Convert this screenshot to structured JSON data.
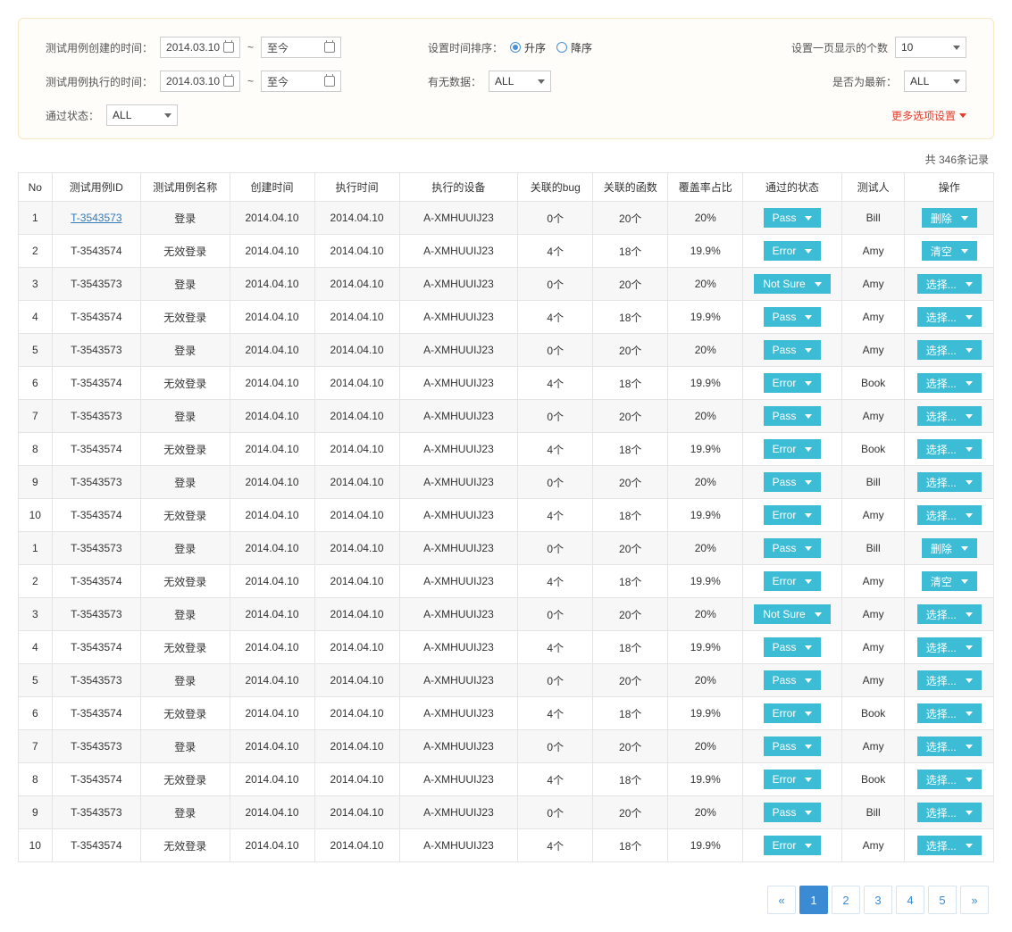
{
  "filters": {
    "created_label": "测试用例创建的时间：",
    "created_from": "2014.03.10",
    "created_to": "至今",
    "executed_label": "测试用例执行的时间：",
    "executed_from": "2014.03.10",
    "executed_to": "至今",
    "sort_label": "设置时间排序：",
    "sort_asc": "升序",
    "sort_desc": "降序",
    "sort_selected": "asc",
    "has_data_label": "有无数据：",
    "has_data_value": "ALL",
    "page_size_label": "设置一页显示的个数",
    "page_size_value": "10",
    "is_latest_label": "是否为最新：",
    "is_latest_value": "ALL",
    "pass_state_label": "通过状态：",
    "pass_state_value": "ALL",
    "more_options": "更多选项设置"
  },
  "count_label": "共 346条记录",
  "columns": [
    "No",
    "测试用例ID",
    "测试用例名称",
    "创建时间",
    "执行时间",
    "执行的设备",
    "关联的bug",
    "关联的函数",
    "覆盖率占比",
    "通过的状态",
    "测试人",
    "操作"
  ],
  "rows": [
    {
      "no": "1",
      "id": "T-3543573",
      "id_link": true,
      "name": "登录",
      "cdate": "2014.04.10",
      "edate": "2014.04.10",
      "device": "A-XMHUUIJ23",
      "bug": "0个",
      "fn": "20个",
      "cov": "20%",
      "state": "Pass",
      "tester": "Bill",
      "action": "删除"
    },
    {
      "no": "2",
      "id": "T-3543574",
      "name": "无效登录",
      "cdate": "2014.04.10",
      "edate": "2014.04.10",
      "device": "A-XMHUUIJ23",
      "bug": "4个",
      "fn": "18个",
      "cov": "19.9%",
      "state": "Error",
      "tester": "Amy",
      "action": "清空"
    },
    {
      "no": "3",
      "id": "T-3543573",
      "name": "登录",
      "cdate": "2014.04.10",
      "edate": "2014.04.10",
      "device": "A-XMHUUIJ23",
      "bug": "0个",
      "fn": "20个",
      "cov": "20%",
      "state": "Not Sure",
      "tester": "Amy",
      "action": "选择..."
    },
    {
      "no": "4",
      "id": "T-3543574",
      "name": "无效登录",
      "cdate": "2014.04.10",
      "edate": "2014.04.10",
      "device": "A-XMHUUIJ23",
      "bug": "4个",
      "fn": "18个",
      "cov": "19.9%",
      "state": "Pass",
      "tester": "Amy",
      "action": "选择..."
    },
    {
      "no": "5",
      "id": "T-3543573",
      "name": "登录",
      "cdate": "2014.04.10",
      "edate": "2014.04.10",
      "device": "A-XMHUUIJ23",
      "bug": "0个",
      "fn": "20个",
      "cov": "20%",
      "state": "Pass",
      "tester": "Amy",
      "action": "选择..."
    },
    {
      "no": "6",
      "id": "T-3543574",
      "name": "无效登录",
      "cdate": "2014.04.10",
      "edate": "2014.04.10",
      "device": "A-XMHUUIJ23",
      "bug": "4个",
      "fn": "18个",
      "cov": "19.9%",
      "state": "Error",
      "tester": "Book",
      "action": "选择..."
    },
    {
      "no": "7",
      "id": "T-3543573",
      "name": "登录",
      "cdate": "2014.04.10",
      "edate": "2014.04.10",
      "device": "A-XMHUUIJ23",
      "bug": "0个",
      "fn": "20个",
      "cov": "20%",
      "state": "Pass",
      "tester": "Amy",
      "action": "选择..."
    },
    {
      "no": "8",
      "id": "T-3543574",
      "name": "无效登录",
      "cdate": "2014.04.10",
      "edate": "2014.04.10",
      "device": "A-XMHUUIJ23",
      "bug": "4个",
      "fn": "18个",
      "cov": "19.9%",
      "state": "Error",
      "tester": "Book",
      "action": "选择..."
    },
    {
      "no": "9",
      "id": "T-3543573",
      "name": "登录",
      "cdate": "2014.04.10",
      "edate": "2014.04.10",
      "device": "A-XMHUUIJ23",
      "bug": "0个",
      "fn": "20个",
      "cov": "20%",
      "state": "Pass",
      "tester": "Bill",
      "action": "选择..."
    },
    {
      "no": "10",
      "id": "T-3543574",
      "name": "无效登录",
      "cdate": "2014.04.10",
      "edate": "2014.04.10",
      "device": "A-XMHUUIJ23",
      "bug": "4个",
      "fn": "18个",
      "cov": "19.9%",
      "state": "Error",
      "tester": "Amy",
      "action": "选择..."
    },
    {
      "no": "1",
      "id": "T-3543573",
      "name": "登录",
      "cdate": "2014.04.10",
      "edate": "2014.04.10",
      "device": "A-XMHUUIJ23",
      "bug": "0个",
      "fn": "20个",
      "cov": "20%",
      "state": "Pass",
      "tester": "Bill",
      "action": "删除"
    },
    {
      "no": "2",
      "id": "T-3543574",
      "name": "无效登录",
      "cdate": "2014.04.10",
      "edate": "2014.04.10",
      "device": "A-XMHUUIJ23",
      "bug": "4个",
      "fn": "18个",
      "cov": "19.9%",
      "state": "Error",
      "tester": "Amy",
      "action": "清空"
    },
    {
      "no": "3",
      "id": "T-3543573",
      "name": "登录",
      "cdate": "2014.04.10",
      "edate": "2014.04.10",
      "device": "A-XMHUUIJ23",
      "bug": "0个",
      "fn": "20个",
      "cov": "20%",
      "state": "Not Sure",
      "tester": "Amy",
      "action": "选择..."
    },
    {
      "no": "4",
      "id": "T-3543574",
      "name": "无效登录",
      "cdate": "2014.04.10",
      "edate": "2014.04.10",
      "device": "A-XMHUUIJ23",
      "bug": "4个",
      "fn": "18个",
      "cov": "19.9%",
      "state": "Pass",
      "tester": "Amy",
      "action": "选择..."
    },
    {
      "no": "5",
      "id": "T-3543573",
      "name": "登录",
      "cdate": "2014.04.10",
      "edate": "2014.04.10",
      "device": "A-XMHUUIJ23",
      "bug": "0个",
      "fn": "20个",
      "cov": "20%",
      "state": "Pass",
      "tester": "Amy",
      "action": "选择..."
    },
    {
      "no": "6",
      "id": "T-3543574",
      "name": "无效登录",
      "cdate": "2014.04.10",
      "edate": "2014.04.10",
      "device": "A-XMHUUIJ23",
      "bug": "4个",
      "fn": "18个",
      "cov": "19.9%",
      "state": "Error",
      "tester": "Book",
      "action": "选择..."
    },
    {
      "no": "7",
      "id": "T-3543573",
      "name": "登录",
      "cdate": "2014.04.10",
      "edate": "2014.04.10",
      "device": "A-XMHUUIJ23",
      "bug": "0个",
      "fn": "20个",
      "cov": "20%",
      "state": "Pass",
      "tester": "Amy",
      "action": "选择..."
    },
    {
      "no": "8",
      "id": "T-3543574",
      "name": "无效登录",
      "cdate": "2014.04.10",
      "edate": "2014.04.10",
      "device": "A-XMHUUIJ23",
      "bug": "4个",
      "fn": "18个",
      "cov": "19.9%",
      "state": "Error",
      "tester": "Book",
      "action": "选择..."
    },
    {
      "no": "9",
      "id": "T-3543573",
      "name": "登录",
      "cdate": "2014.04.10",
      "edate": "2014.04.10",
      "device": "A-XMHUUIJ23",
      "bug": "0个",
      "fn": "20个",
      "cov": "20%",
      "state": "Pass",
      "tester": "Bill",
      "action": "选择..."
    },
    {
      "no": "10",
      "id": "T-3543574",
      "name": "无效登录",
      "cdate": "2014.04.10",
      "edate": "2014.04.10",
      "device": "A-XMHUUIJ23",
      "bug": "4个",
      "fn": "18个",
      "cov": "19.9%",
      "state": "Error",
      "tester": "Amy",
      "action": "选择..."
    }
  ],
  "pagination": {
    "prev": "«",
    "pages": [
      "1",
      "2",
      "3",
      "4",
      "5"
    ],
    "next": "»",
    "active": "1"
  }
}
